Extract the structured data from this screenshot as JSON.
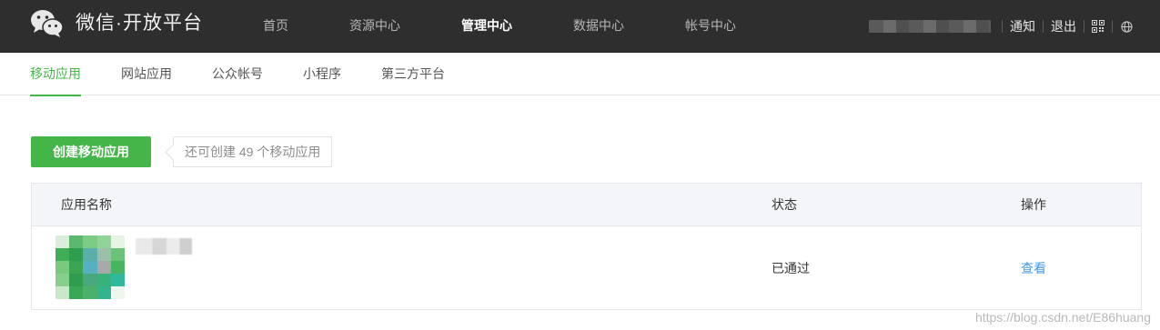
{
  "brand": {
    "name": "微信·开放平台",
    "logo_icon": "wechat-logo-icon"
  },
  "main_nav": [
    {
      "label": "首页",
      "active": false
    },
    {
      "label": "资源中心",
      "active": false
    },
    {
      "label": "管理中心",
      "active": true
    },
    {
      "label": "数据中心",
      "active": false
    },
    {
      "label": "帐号中心",
      "active": false
    }
  ],
  "account": {
    "notice_label": "通知",
    "logout_label": "退出",
    "qrcode_icon": "qrcode-icon",
    "language_icon": "globe-icon"
  },
  "sub_tabs": [
    {
      "label": "移动应用",
      "active": true
    },
    {
      "label": "网站应用",
      "active": false
    },
    {
      "label": "公众帐号",
      "active": false
    },
    {
      "label": "小程序",
      "active": false
    },
    {
      "label": "第三方平台",
      "active": false
    }
  ],
  "toolbar": {
    "create_label": "创建移动应用",
    "quota_text": "还可创建 49 个移动应用"
  },
  "table": {
    "columns": {
      "name": "应用名称",
      "status": "状态",
      "action": "操作"
    },
    "rows": [
      {
        "status": "已通过",
        "action": "查看"
      }
    ]
  },
  "watermark": "https://blog.csdn.net/E86huang",
  "colors": {
    "accent": "#44b549",
    "topbar": "#2e2e2e",
    "link": "#459ae9"
  }
}
